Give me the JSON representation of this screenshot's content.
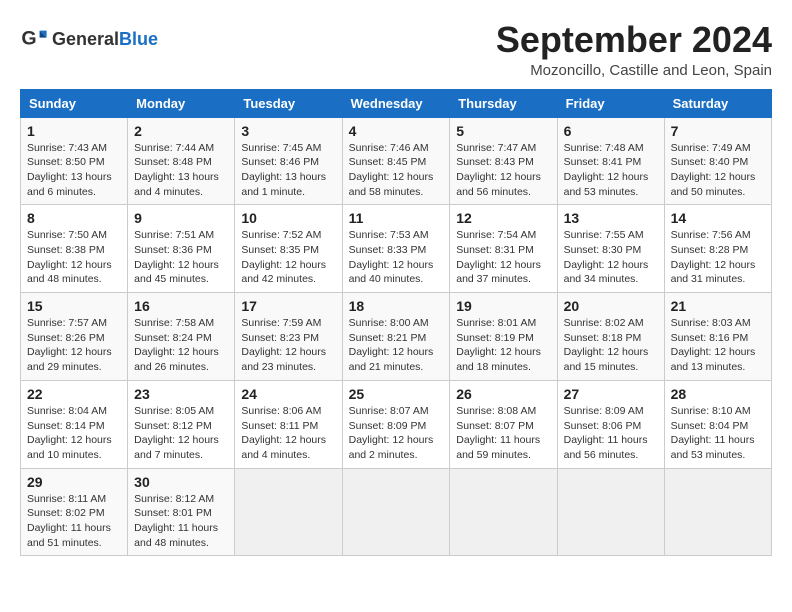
{
  "header": {
    "logo_general": "General",
    "logo_blue": "Blue",
    "month_title": "September 2024",
    "location": "Mozoncillo, Castille and Leon, Spain"
  },
  "weekdays": [
    "Sunday",
    "Monday",
    "Tuesday",
    "Wednesday",
    "Thursday",
    "Friday",
    "Saturday"
  ],
  "weeks": [
    [
      {
        "day": "1",
        "sunrise": "7:43 AM",
        "sunset": "8:50 PM",
        "daylight": "13 hours and 6 minutes."
      },
      {
        "day": "2",
        "sunrise": "7:44 AM",
        "sunset": "8:48 PM",
        "daylight": "13 hours and 4 minutes."
      },
      {
        "day": "3",
        "sunrise": "7:45 AM",
        "sunset": "8:46 PM",
        "daylight": "13 hours and 1 minute."
      },
      {
        "day": "4",
        "sunrise": "7:46 AM",
        "sunset": "8:45 PM",
        "daylight": "12 hours and 58 minutes."
      },
      {
        "day": "5",
        "sunrise": "7:47 AM",
        "sunset": "8:43 PM",
        "daylight": "12 hours and 56 minutes."
      },
      {
        "day": "6",
        "sunrise": "7:48 AM",
        "sunset": "8:41 PM",
        "daylight": "12 hours and 53 minutes."
      },
      {
        "day": "7",
        "sunrise": "7:49 AM",
        "sunset": "8:40 PM",
        "daylight": "12 hours and 50 minutes."
      }
    ],
    [
      {
        "day": "8",
        "sunrise": "7:50 AM",
        "sunset": "8:38 PM",
        "daylight": "12 hours and 48 minutes."
      },
      {
        "day": "9",
        "sunrise": "7:51 AM",
        "sunset": "8:36 PM",
        "daylight": "12 hours and 45 minutes."
      },
      {
        "day": "10",
        "sunrise": "7:52 AM",
        "sunset": "8:35 PM",
        "daylight": "12 hours and 42 minutes."
      },
      {
        "day": "11",
        "sunrise": "7:53 AM",
        "sunset": "8:33 PM",
        "daylight": "12 hours and 40 minutes."
      },
      {
        "day": "12",
        "sunrise": "7:54 AM",
        "sunset": "8:31 PM",
        "daylight": "12 hours and 37 minutes."
      },
      {
        "day": "13",
        "sunrise": "7:55 AM",
        "sunset": "8:30 PM",
        "daylight": "12 hours and 34 minutes."
      },
      {
        "day": "14",
        "sunrise": "7:56 AM",
        "sunset": "8:28 PM",
        "daylight": "12 hours and 31 minutes."
      }
    ],
    [
      {
        "day": "15",
        "sunrise": "7:57 AM",
        "sunset": "8:26 PM",
        "daylight": "12 hours and 29 minutes."
      },
      {
        "day": "16",
        "sunrise": "7:58 AM",
        "sunset": "8:24 PM",
        "daylight": "12 hours and 26 minutes."
      },
      {
        "day": "17",
        "sunrise": "7:59 AM",
        "sunset": "8:23 PM",
        "daylight": "12 hours and 23 minutes."
      },
      {
        "day": "18",
        "sunrise": "8:00 AM",
        "sunset": "8:21 PM",
        "daylight": "12 hours and 21 minutes."
      },
      {
        "day": "19",
        "sunrise": "8:01 AM",
        "sunset": "8:19 PM",
        "daylight": "12 hours and 18 minutes."
      },
      {
        "day": "20",
        "sunrise": "8:02 AM",
        "sunset": "8:18 PM",
        "daylight": "12 hours and 15 minutes."
      },
      {
        "day": "21",
        "sunrise": "8:03 AM",
        "sunset": "8:16 PM",
        "daylight": "12 hours and 13 minutes."
      }
    ],
    [
      {
        "day": "22",
        "sunrise": "8:04 AM",
        "sunset": "8:14 PM",
        "daylight": "12 hours and 10 minutes."
      },
      {
        "day": "23",
        "sunrise": "8:05 AM",
        "sunset": "8:12 PM",
        "daylight": "12 hours and 7 minutes."
      },
      {
        "day": "24",
        "sunrise": "8:06 AM",
        "sunset": "8:11 PM",
        "daylight": "12 hours and 4 minutes."
      },
      {
        "day": "25",
        "sunrise": "8:07 AM",
        "sunset": "8:09 PM",
        "daylight": "12 hours and 2 minutes."
      },
      {
        "day": "26",
        "sunrise": "8:08 AM",
        "sunset": "8:07 PM",
        "daylight": "11 hours and 59 minutes."
      },
      {
        "day": "27",
        "sunrise": "8:09 AM",
        "sunset": "8:06 PM",
        "daylight": "11 hours and 56 minutes."
      },
      {
        "day": "28",
        "sunrise": "8:10 AM",
        "sunset": "8:04 PM",
        "daylight": "11 hours and 53 minutes."
      }
    ],
    [
      {
        "day": "29",
        "sunrise": "8:11 AM",
        "sunset": "8:02 PM",
        "daylight": "11 hours and 51 minutes."
      },
      {
        "day": "30",
        "sunrise": "8:12 AM",
        "sunset": "8:01 PM",
        "daylight": "11 hours and 48 minutes."
      },
      null,
      null,
      null,
      null,
      null
    ]
  ]
}
